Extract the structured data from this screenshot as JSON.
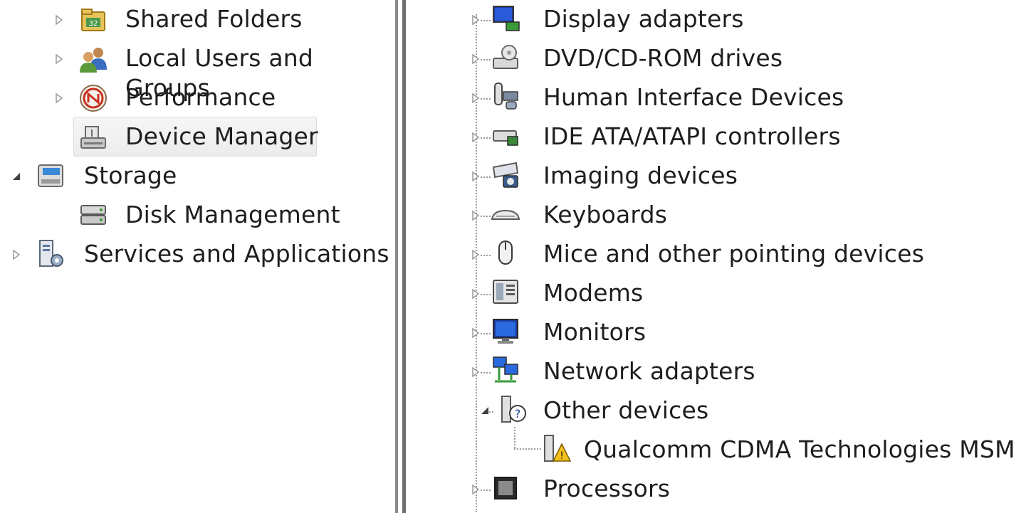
{
  "left_tree": {
    "items": [
      {
        "label": "Shared Folders",
        "expander": "collapsed",
        "icon": "shared-folders-icon"
      },
      {
        "label": "Local Users and Groups",
        "expander": "collapsed",
        "icon": "users-groups-icon"
      },
      {
        "label": "Performance",
        "expander": "collapsed",
        "icon": "performance-icon"
      },
      {
        "label": "Device Manager",
        "expander": "none",
        "icon": "device-manager-icon",
        "selected": true
      },
      {
        "label": "Storage",
        "expander": "expanded",
        "icon": "storage-icon"
      },
      {
        "label": "Disk Management",
        "expander": "none",
        "icon": "disk-management-icon"
      },
      {
        "label": "Services and Applications",
        "expander": "collapsed",
        "icon": "services-icon"
      }
    ]
  },
  "device_tree": {
    "items": [
      {
        "label": "Display adapters",
        "expander": "collapsed",
        "icon": "display-adapter-icon"
      },
      {
        "label": "DVD/CD-ROM drives",
        "expander": "collapsed",
        "icon": "dvd-drive-icon"
      },
      {
        "label": "Human Interface Devices",
        "expander": "collapsed",
        "icon": "hid-icon"
      },
      {
        "label": "IDE ATA/ATAPI controllers",
        "expander": "collapsed",
        "icon": "ide-controller-icon"
      },
      {
        "label": "Imaging devices",
        "expander": "collapsed",
        "icon": "imaging-device-icon"
      },
      {
        "label": "Keyboards",
        "expander": "collapsed",
        "icon": "keyboard-icon"
      },
      {
        "label": "Mice and other pointing devices",
        "expander": "collapsed",
        "icon": "mouse-icon"
      },
      {
        "label": "Modems",
        "expander": "collapsed",
        "icon": "modem-icon"
      },
      {
        "label": "Monitors",
        "expander": "collapsed",
        "icon": "monitor-icon"
      },
      {
        "label": "Network adapters",
        "expander": "collapsed",
        "icon": "network-adapter-icon"
      },
      {
        "label": "Other devices",
        "expander": "expanded",
        "icon": "unknown-device-icon"
      },
      {
        "label": "Qualcomm CDMA Technologies MSM",
        "expander": "none",
        "icon": "warning-device-icon"
      },
      {
        "label": "Processors",
        "expander": "collapsed",
        "icon": "processor-icon"
      }
    ]
  },
  "colors": {
    "text": "#1e1e1e",
    "selection": "#eeeeee",
    "splitter": "#7a7a7a",
    "tree_lines": "#9a9a9a",
    "warning": "#f2c21b"
  }
}
